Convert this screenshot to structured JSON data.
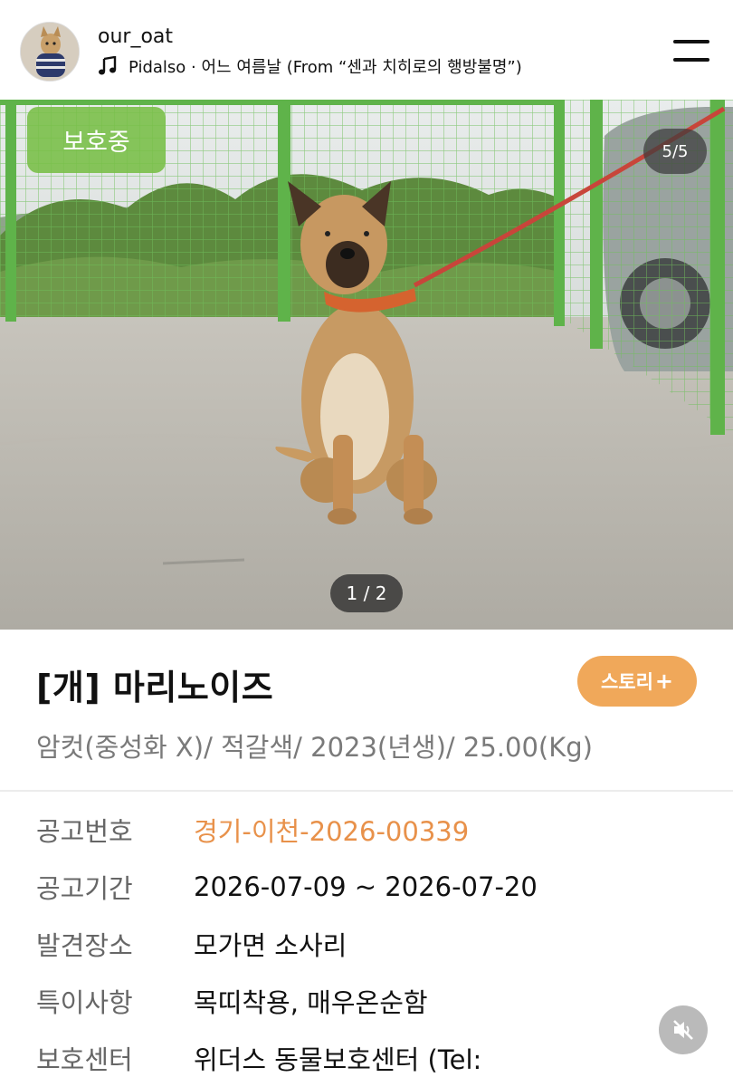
{
  "post": {
    "username": "our_oat",
    "music": "Pidalso · 어느 여름날 (From “센과 치히로의 행방불명”)",
    "music_icon": "music-note-icon",
    "menu_icon": "menu-icon"
  },
  "photo": {
    "status_badge": "보호중",
    "carousel_counter": "5/5",
    "image_counter": "1 / 2"
  },
  "animal": {
    "title": "[개] 마리노이즈",
    "story_button": "스토리",
    "story_button_plus": "+",
    "summary": "암컷(중성화 X)/ 적갈색/ 2023(년생)/ 25.00(Kg)"
  },
  "details": [
    {
      "label": "공고번호",
      "value": "경기-이천-2026-00339"
    },
    {
      "label": "공고기간",
      "value": "2026-07-09 ~ 2026-07-20"
    },
    {
      "label": "발견장소",
      "value": "모가면 소사리"
    },
    {
      "label": "특이사항",
      "value": "목띠착용, 매우온순함"
    },
    {
      "label": "보호센터",
      "value": "위더스 동물보호센터 (Tel:"
    }
  ],
  "colors": {
    "accent_orange": "#e8914a",
    "story_button": "#f0a85a",
    "status_green": "#78be46"
  },
  "mute_icon": "speaker-muted-icon"
}
